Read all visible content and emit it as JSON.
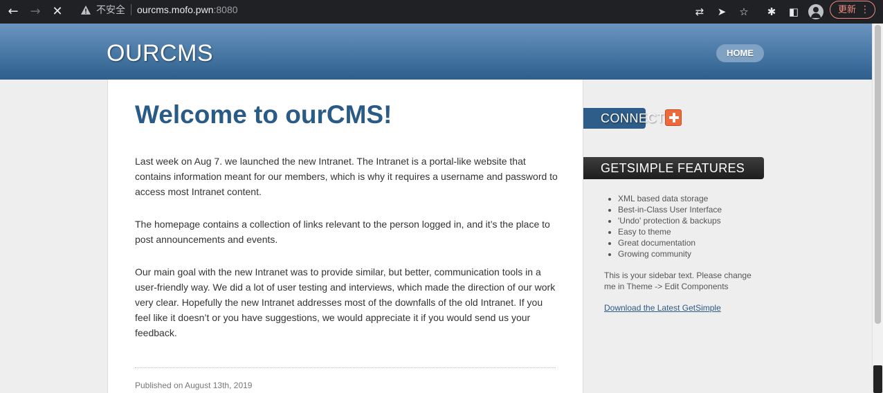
{
  "browser": {
    "security_label": "不安全",
    "url_host": "ourcms.mofo.pwn",
    "url_port": ":8080",
    "update_label": "更新"
  },
  "site": {
    "logo": "OURCMS",
    "nav_home": "HOME"
  },
  "article": {
    "title": "Welcome to ourCMS!",
    "paragraphs": [
      "Last week on Aug 7. we launched the new Intranet. The Intranet is a portal-like website that contains information meant for our members, which is why it requires a username and password to access most Intranet content.",
      "The homepage contains a collection of links relevant to the person logged in, and it’s the place to post announcements and events.",
      "Our main goal with the new Intranet was to provide similar, but better, communication tools in a user-friendly way. We did a lot of user testing and interviews, which made the direction of our work very clear. Hopefully the new Intranet addresses most of the downfalls of the old Intranet. If you feel like it doesn’t or you have suggestions, we would appreciate it if you would send us your feedback."
    ],
    "published": "Published on August 13th, 2019"
  },
  "sidebar": {
    "connect_label": "CONNECT",
    "features_title": "GETSIMPLE FEATURES",
    "features": [
      "XML based data storage",
      "Best-in-Class User Interface",
      "'Undo' protection & backups",
      "Easy to theme",
      "Great documentation",
      "Growing community"
    ],
    "text": "This is your sidebar text. Please change me in Theme -> Edit Components",
    "link": "Download the Latest GetSimple"
  },
  "colors": {
    "header_top": "#6a95c0",
    "header_bottom": "#2d5f8c",
    "title": "#2a5a86",
    "plus_accent": "#ef6a3a"
  }
}
